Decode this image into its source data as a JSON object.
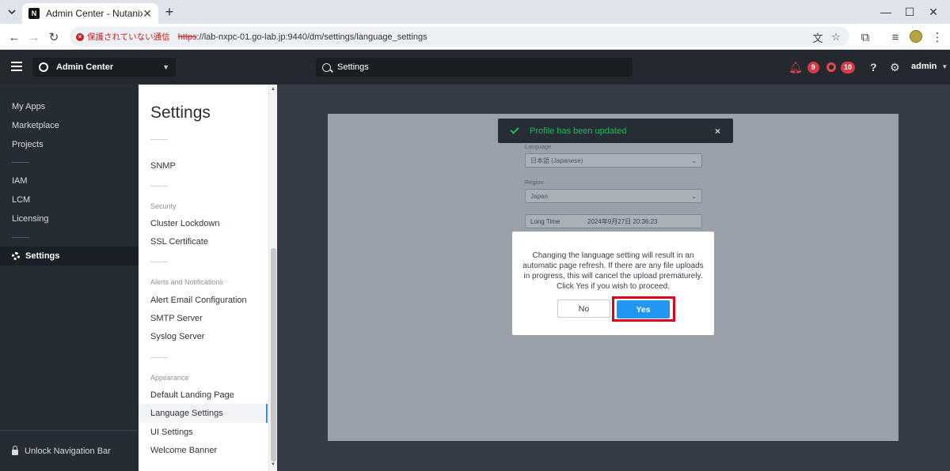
{
  "browser": {
    "tab_title": "Admin Center - Nutanix",
    "favicon_text": "N",
    "security_chip": "保護されていない通信",
    "url_scheme": "https",
    "url_rest": "://lab-nxpc-01.go-lab.jp:9440/dm/settings/language_settings"
  },
  "header": {
    "app_name": "Admin Center",
    "search_text": "Settings",
    "alerts_count": "9",
    "tasks_count": "10",
    "help_label": "?",
    "user": "admin"
  },
  "leftnav": {
    "items_top": [
      "My Apps",
      "Marketplace",
      "Projects"
    ],
    "items_mid": [
      "IAM",
      "LCM",
      "Licensing"
    ],
    "active_item": "Settings",
    "unlock_label": "Unlock Navigation Bar"
  },
  "settings": {
    "title": "Settings",
    "snmp": "SNMP",
    "security_section": "Security",
    "cluster_lockdown": "Cluster Lockdown",
    "ssl_certificate": "SSL Certificate",
    "alerts_section": "Alerts and Notifications",
    "alert_email": "Alert Email Configuration",
    "smtp_server": "SMTP Server",
    "syslog_server": "Syslog Server",
    "appearance_section": "Appearance",
    "default_landing": "Default Landing Page",
    "language_settings": "Language Settings",
    "ui_settings": "UI Settings",
    "welcome_banner": "Welcome Banner"
  },
  "form": {
    "language_label": "Language",
    "language_value": "日本語 (Japanese)",
    "region_label": "Region",
    "region_value": "Japan",
    "long_time_label": "Long Time",
    "long_time_value": "2024年9月27日 20:36:23"
  },
  "toast": {
    "message": "Profile has been updated",
    "close": "×"
  },
  "dialog": {
    "message": "Changing the language setting will result in an automatic page refresh. If there are any file uploads in progress, this will cancel the upload prematurely. Click Yes if you wish to proceed.",
    "no_label": "No",
    "yes_label": "Yes"
  },
  "colors": {
    "header_bg": "#24292f",
    "nav_bg": "#262c33",
    "accent_blue": "#2196f3",
    "success_green": "#1fb95b",
    "badge_red": "#d63a47",
    "highlight_red": "#e2001a"
  }
}
